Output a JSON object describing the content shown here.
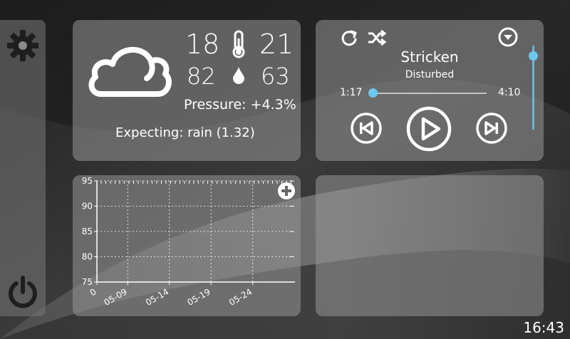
{
  "weather": {
    "temp_low": "18",
    "temp_high": "21",
    "humidity_low": "82",
    "humidity_high": "63",
    "pressure": "Pressure: +4.3%",
    "expecting": "Expecting: rain (1.32)",
    "condition_icon": "cloud-icon"
  },
  "player": {
    "title": "Stricken",
    "artist": "Disturbed",
    "elapsed": "1:17",
    "duration": "4:10",
    "progress_fraction": 0.01,
    "volume_fraction": 0.88
  },
  "chart_data": {
    "type": "line",
    "yticks": [
      "95",
      "90",
      "85",
      "80",
      "75"
    ],
    "xticks": [
      "0",
      "05-09",
      "05-14",
      "05-19",
      "05-24"
    ],
    "ylim": [
      75,
      95
    ],
    "grid": true
  },
  "clock": "16:43",
  "sidebar": {
    "settings_icon": "gear-icon",
    "power_icon": "power-icon"
  }
}
